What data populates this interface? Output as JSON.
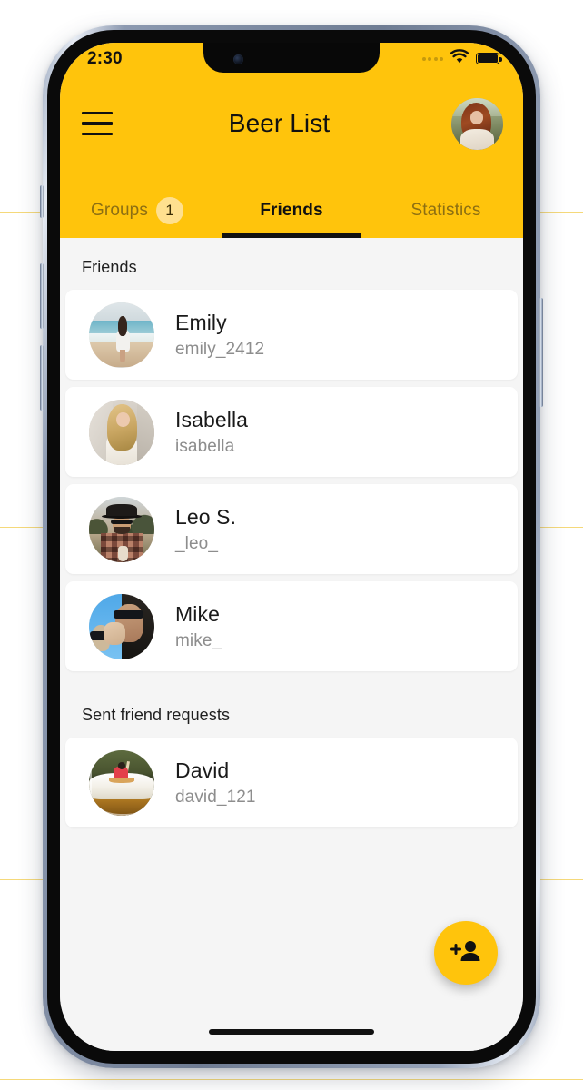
{
  "status_bar": {
    "time": "2:30",
    "signal_icon": "signal-dots-icon",
    "wifi_icon": "wifi-icon",
    "battery_icon": "battery-full-icon"
  },
  "header": {
    "menu_icon": "hamburger-menu-icon",
    "title": "Beer List",
    "avatar_icon": "user-avatar",
    "background_color": "#FFC40C"
  },
  "tabs": [
    {
      "label": "Groups",
      "badge": "1",
      "active": false
    },
    {
      "label": "Friends",
      "badge": null,
      "active": true
    },
    {
      "label": "Statistics",
      "badge": null,
      "active": false
    }
  ],
  "sections": [
    {
      "title": "Friends",
      "rows": [
        {
          "name": "Emily",
          "handle": "emily_2412",
          "avatar": "emily-avatar"
        },
        {
          "name": "Isabella",
          "handle": "isabella",
          "avatar": "isabella-avatar"
        },
        {
          "name": "Leo S.",
          "handle": "_leo_",
          "avatar": "leo-avatar"
        },
        {
          "name": "Mike",
          "handle": "mike_",
          "avatar": "mike-avatar"
        }
      ]
    },
    {
      "title": "Sent friend requests",
      "rows": [
        {
          "name": "David",
          "handle": "david_121",
          "avatar": "david-avatar"
        }
      ]
    }
  ],
  "fab": {
    "icon": "person-add-icon",
    "color": "#FFC40C"
  },
  "colors": {
    "accent": "#FFC40C",
    "badge": "#FFE08F",
    "content_background": "#F5F5F5",
    "card_background": "#FFFFFF",
    "primary_text": "#1A1A1A",
    "secondary_text": "#8D8D8D",
    "inactive_tab_text": "#8D6F12"
  }
}
